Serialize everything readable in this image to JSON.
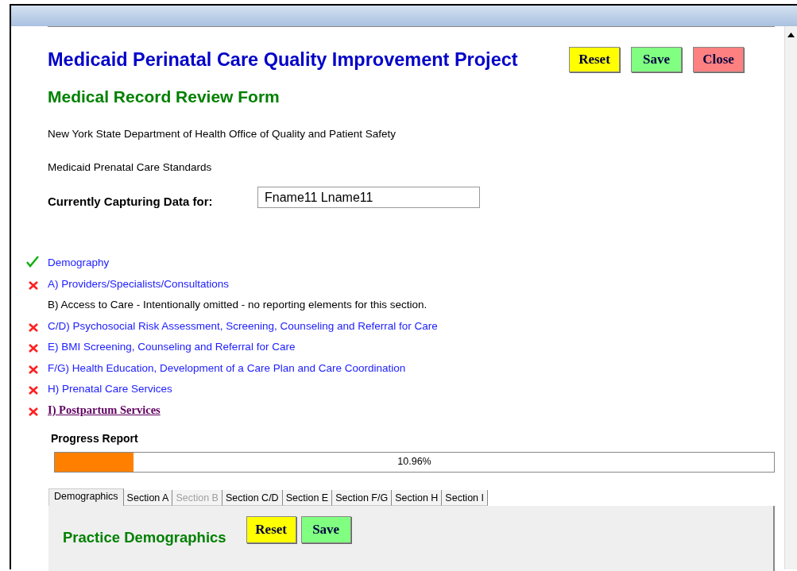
{
  "header": {
    "title": "Medicaid Perinatal Care Quality Improvement Project",
    "buttons": [
      {
        "label": "Reset",
        "kind": "reset"
      },
      {
        "label": "Save",
        "kind": "save"
      },
      {
        "label": "Close",
        "kind": "close"
      }
    ]
  },
  "subtitle": "Medical Record Review Form",
  "department": "New York State Department of Health Office of Quality and Patient Safety",
  "standards": "Medicaid Prenatal Care Standards",
  "capture": {
    "label": "Currently Capturing Data for:",
    "value": "Fname11 Lname11"
  },
  "sections": [
    {
      "label": "Demography",
      "complete": true,
      "kind": "link",
      "selected": false
    },
    {
      "label": "A)  Providers/Specialists/Consultations",
      "complete": false,
      "kind": "link",
      "selected": false
    },
    {
      "label": "B) Access to Care - Intentionally omitted - no reporting elements for this section.",
      "kind": "text",
      "selected": false
    },
    {
      "label": "C/D)  Psychosocial Risk Assessment, Screening, Counseling and Referral for Care",
      "complete": false,
      "kind": "link",
      "selected": false
    },
    {
      "label": "E)  BMI Screening, Counseling and Referral for Care",
      "complete": false,
      "kind": "link",
      "selected": false
    },
    {
      "label": "F/G)  Health Education, Development of a Care Plan and Care Coordination",
      "complete": false,
      "kind": "link",
      "selected": false
    },
    {
      "label": "H) Prenatal Care Services",
      "complete": false,
      "kind": "link",
      "selected": false
    },
    {
      "label": "I)  Postpartum Services",
      "complete": false,
      "kind": "link",
      "selected": true
    }
  ],
  "progress": {
    "title": "Progress Report",
    "level": 0.1096,
    "reading": "10.96%"
  },
  "tabs": [
    {
      "label": "Demographics",
      "selected": true,
      "disabled": false
    },
    {
      "label": "Section A",
      "selected": false,
      "disabled": false
    },
    {
      "label": "Section B",
      "selected": false,
      "disabled": true
    },
    {
      "label": "Section C/D",
      "selected": false,
      "disabled": false
    },
    {
      "label": "Section E",
      "selected": false,
      "disabled": false
    },
    {
      "label": "Section F/G",
      "selected": false,
      "disabled": false
    },
    {
      "label": "Section H",
      "selected": false,
      "disabled": false
    },
    {
      "label": "Section I",
      "selected": false,
      "disabled": false
    }
  ],
  "panel": {
    "title": "Practice Demographics",
    "buttons": [
      {
        "label": "Reset",
        "kind": "reset"
      },
      {
        "label": "Save",
        "kind": "save"
      }
    ]
  }
}
